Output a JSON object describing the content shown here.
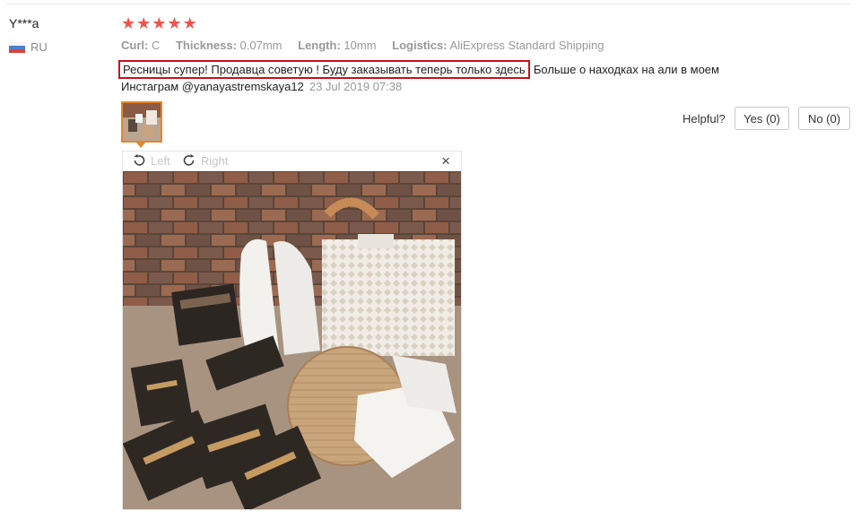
{
  "reviewer": {
    "name": "Y***a",
    "country": "RU"
  },
  "rating": {
    "stars": 5,
    "max": 5,
    "color": "#f2534a"
  },
  "attributes": [
    {
      "key": "Curl:",
      "value": "C"
    },
    {
      "key": "Thickness:",
      "value": "0.07mm"
    },
    {
      "key": "Length:",
      "value": "10mm"
    },
    {
      "key": "Logistics:",
      "value": "AliExpress Standard Shipping"
    }
  ],
  "review": {
    "highlighted": "Ресницы супер! Продавца советую ! Буду заказывать теперь только здесь",
    "rest": ". Больше о находках на али в моем",
    "line2": "Инстаграм @yanayastremskaya12",
    "date": "23 Jul 2019 07:38"
  },
  "helpful": {
    "label": "Helpful?",
    "yes": "Yes (0)",
    "no": "No (0)"
  },
  "viewer": {
    "left_label": "Left",
    "right_label": "Right",
    "close": "×"
  },
  "colors": {
    "highlight_box": "#c8101c",
    "thumb_border": "#e6862c"
  }
}
